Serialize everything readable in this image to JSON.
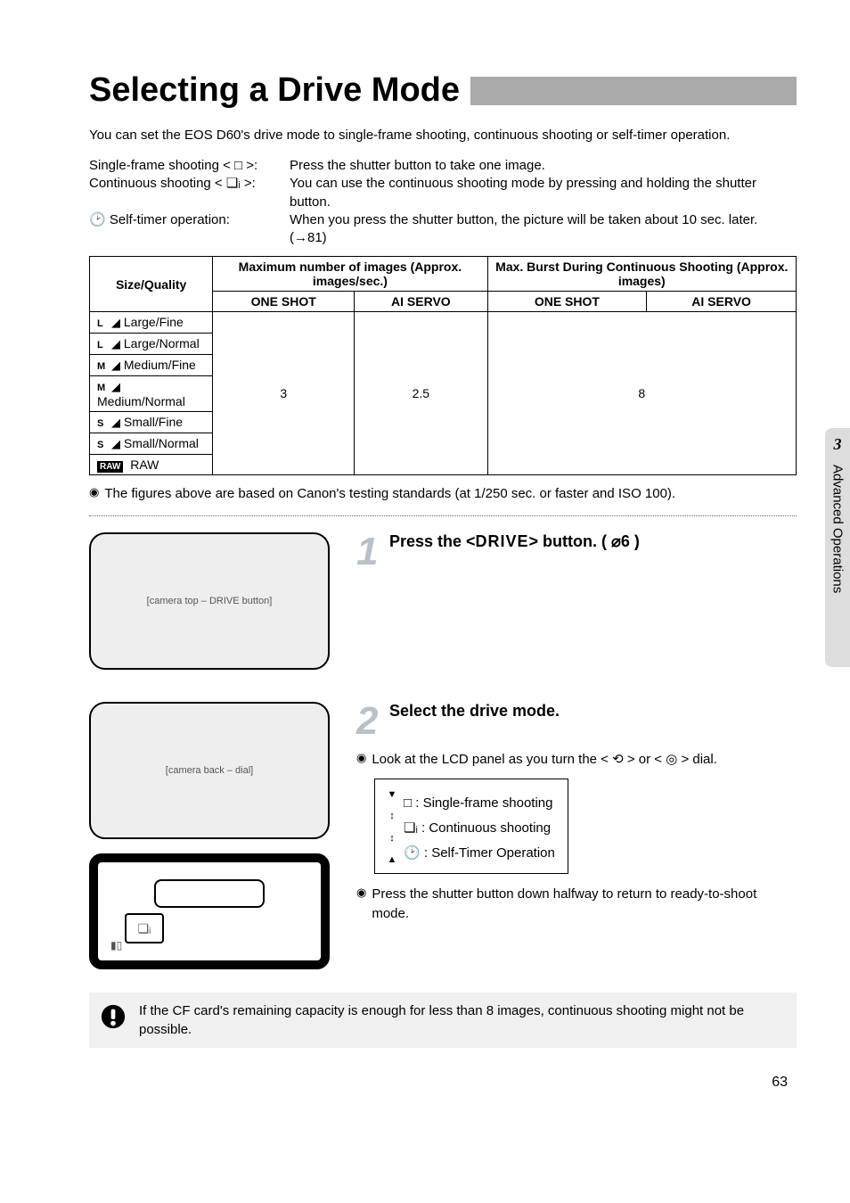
{
  "title": "Selecting a Drive Mode",
  "intro": "You can set the EOS D60's drive mode to single-frame shooting, continuous shooting or self-timer operation.",
  "modes": {
    "single": {
      "label": "Single-frame shooting < □ >:",
      "desc": "Press the shutter button to take one image."
    },
    "cont": {
      "label": "Continuous shooting < ❏ᵢ >:",
      "desc": "You can use the continuous shooting mode by pressing and holding the shutter button."
    },
    "timer": {
      "label": "🕑 Self-timer operation:",
      "desc": "When you press the shutter button, the picture will be taken about 10 sec. later. (→81)"
    }
  },
  "table": {
    "h_size": "Size/Quality",
    "h_max": "Maximum number of images (Approx. images/sec.)",
    "h_burst": "Max. Burst During Continuous Shooting (Approx. images)",
    "sub_one": "ONE SHOT",
    "sub_ai": "AI SERVO",
    "rows": [
      {
        "ic": "L",
        "q": "◢",
        "label": "Large/Fine"
      },
      {
        "ic": "L",
        "q": "◢",
        "label": "Large/Normal"
      },
      {
        "ic": "M",
        "q": "◢",
        "label": "Medium/Fine"
      },
      {
        "ic": "M",
        "q": "◢",
        "label": "Medium/Normal"
      },
      {
        "ic": "S",
        "q": "◢",
        "label": "Small/Fine"
      },
      {
        "ic": "S",
        "q": "◢",
        "label": "Small/Normal"
      },
      {
        "ic": "RAW",
        "q": "",
        "label": "RAW"
      }
    ],
    "val_one": "3",
    "val_ai": "2.5",
    "val_burst": "8"
  },
  "table_note": "The figures above are based on Canon's testing standards (at 1/250 sec. or faster and ISO 100).",
  "step1": {
    "num": "1",
    "title_a": "Press the <",
    "title_b": "DRIVE",
    "title_c": "> button. ( ⌀6 )"
  },
  "step2": {
    "num": "2",
    "title": "Select the drive mode.",
    "b1": "Look at the LCD panel as you turn the < ⟲ > or < ◎ > dial.",
    "leg_single": ": Single-frame shooting",
    "leg_cont": ": Continuous shooting",
    "leg_timer": ": Self-Timer Operation",
    "b2": "Press the shutter button down halfway to return to ready-to-shoot mode."
  },
  "warning": "If the CF card's remaining capacity is enough for less than 8 images, continuous shooting might not be possible.",
  "sidebar": {
    "num": "3",
    "label": "Advanced Operations"
  },
  "page_number": "63",
  "img_alt1": "[camera top – DRIVE button]",
  "img_alt2": "[camera back – dial]",
  "lcd_icon": "❏ᵢ",
  "lcd_bat": "▮▯"
}
